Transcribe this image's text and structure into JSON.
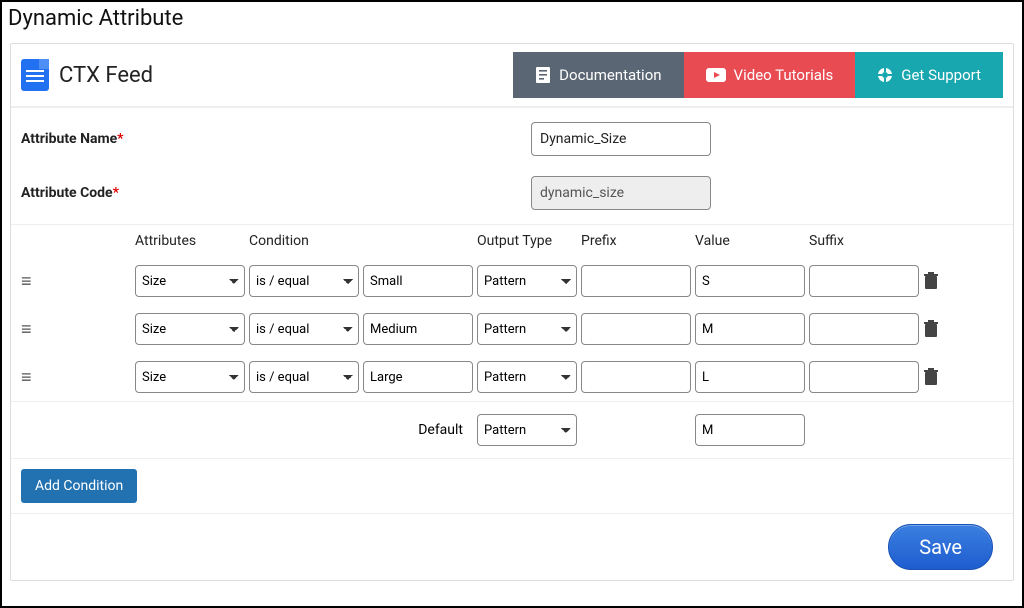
{
  "page_title": "Dynamic Attribute",
  "brand": {
    "name": "CTX Feed"
  },
  "header_buttons": {
    "documentation": "Documentation",
    "video_tutorials": "Video Tutorials",
    "get_support": "Get Support"
  },
  "form": {
    "attribute_name_label": "Attribute Name",
    "attribute_name_value": "Dynamic_Size",
    "attribute_code_label": "Attribute Code",
    "attribute_code_value": "dynamic_size"
  },
  "columns": {
    "attributes": "Attributes",
    "condition": "Condition",
    "output_type": "Output Type",
    "prefix": "Prefix",
    "value": "Value",
    "suffix": "Suffix"
  },
  "rows": [
    {
      "attribute": "Size",
      "condition": "is / equal",
      "condition_value": "Small",
      "output_type": "Pattern",
      "prefix": "",
      "value": "S",
      "suffix": ""
    },
    {
      "attribute": "Size",
      "condition": "is / equal",
      "condition_value": "Medium",
      "output_type": "Pattern",
      "prefix": "",
      "value": "M",
      "suffix": ""
    },
    {
      "attribute": "Size",
      "condition": "is / equal",
      "condition_value": "Large",
      "output_type": "Pattern",
      "prefix": "",
      "value": "L",
      "suffix": ""
    }
  ],
  "default": {
    "label": "Default",
    "output_type": "Pattern",
    "value": "M"
  },
  "buttons": {
    "add_condition": "Add Condition",
    "save": "Save"
  },
  "required_mark": "*"
}
